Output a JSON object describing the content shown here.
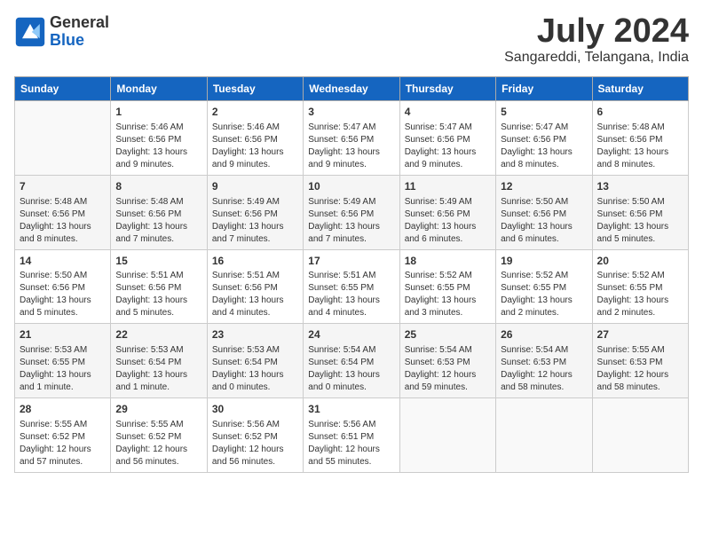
{
  "logo": {
    "text_general": "General",
    "text_blue": "Blue"
  },
  "title": "July 2024",
  "location": "Sangareddi, Telangana, India",
  "days_of_week": [
    "Sunday",
    "Monday",
    "Tuesday",
    "Wednesday",
    "Thursday",
    "Friday",
    "Saturday"
  ],
  "weeks": [
    [
      {
        "day": "",
        "info": ""
      },
      {
        "day": "1",
        "info": "Sunrise: 5:46 AM\nSunset: 6:56 PM\nDaylight: 13 hours\nand 9 minutes."
      },
      {
        "day": "2",
        "info": "Sunrise: 5:46 AM\nSunset: 6:56 PM\nDaylight: 13 hours\nand 9 minutes."
      },
      {
        "day": "3",
        "info": "Sunrise: 5:47 AM\nSunset: 6:56 PM\nDaylight: 13 hours\nand 9 minutes."
      },
      {
        "day": "4",
        "info": "Sunrise: 5:47 AM\nSunset: 6:56 PM\nDaylight: 13 hours\nand 9 minutes."
      },
      {
        "day": "5",
        "info": "Sunrise: 5:47 AM\nSunset: 6:56 PM\nDaylight: 13 hours\nand 8 minutes."
      },
      {
        "day": "6",
        "info": "Sunrise: 5:48 AM\nSunset: 6:56 PM\nDaylight: 13 hours\nand 8 minutes."
      }
    ],
    [
      {
        "day": "7",
        "info": "Sunrise: 5:48 AM\nSunset: 6:56 PM\nDaylight: 13 hours\nand 8 minutes."
      },
      {
        "day": "8",
        "info": "Sunrise: 5:48 AM\nSunset: 6:56 PM\nDaylight: 13 hours\nand 7 minutes."
      },
      {
        "day": "9",
        "info": "Sunrise: 5:49 AM\nSunset: 6:56 PM\nDaylight: 13 hours\nand 7 minutes."
      },
      {
        "day": "10",
        "info": "Sunrise: 5:49 AM\nSunset: 6:56 PM\nDaylight: 13 hours\nand 7 minutes."
      },
      {
        "day": "11",
        "info": "Sunrise: 5:49 AM\nSunset: 6:56 PM\nDaylight: 13 hours\nand 6 minutes."
      },
      {
        "day": "12",
        "info": "Sunrise: 5:50 AM\nSunset: 6:56 PM\nDaylight: 13 hours\nand 6 minutes."
      },
      {
        "day": "13",
        "info": "Sunrise: 5:50 AM\nSunset: 6:56 PM\nDaylight: 13 hours\nand 5 minutes."
      }
    ],
    [
      {
        "day": "14",
        "info": "Sunrise: 5:50 AM\nSunset: 6:56 PM\nDaylight: 13 hours\nand 5 minutes."
      },
      {
        "day": "15",
        "info": "Sunrise: 5:51 AM\nSunset: 6:56 PM\nDaylight: 13 hours\nand 5 minutes."
      },
      {
        "day": "16",
        "info": "Sunrise: 5:51 AM\nSunset: 6:56 PM\nDaylight: 13 hours\nand 4 minutes."
      },
      {
        "day": "17",
        "info": "Sunrise: 5:51 AM\nSunset: 6:55 PM\nDaylight: 13 hours\nand 4 minutes."
      },
      {
        "day": "18",
        "info": "Sunrise: 5:52 AM\nSunset: 6:55 PM\nDaylight: 13 hours\nand 3 minutes."
      },
      {
        "day": "19",
        "info": "Sunrise: 5:52 AM\nSunset: 6:55 PM\nDaylight: 13 hours\nand 2 minutes."
      },
      {
        "day": "20",
        "info": "Sunrise: 5:52 AM\nSunset: 6:55 PM\nDaylight: 13 hours\nand 2 minutes."
      }
    ],
    [
      {
        "day": "21",
        "info": "Sunrise: 5:53 AM\nSunset: 6:55 PM\nDaylight: 13 hours\nand 1 minute."
      },
      {
        "day": "22",
        "info": "Sunrise: 5:53 AM\nSunset: 6:54 PM\nDaylight: 13 hours\nand 1 minute."
      },
      {
        "day": "23",
        "info": "Sunrise: 5:53 AM\nSunset: 6:54 PM\nDaylight: 13 hours\nand 0 minutes."
      },
      {
        "day": "24",
        "info": "Sunrise: 5:54 AM\nSunset: 6:54 PM\nDaylight: 13 hours\nand 0 minutes."
      },
      {
        "day": "25",
        "info": "Sunrise: 5:54 AM\nSunset: 6:53 PM\nDaylight: 12 hours\nand 59 minutes."
      },
      {
        "day": "26",
        "info": "Sunrise: 5:54 AM\nSunset: 6:53 PM\nDaylight: 12 hours\nand 58 minutes."
      },
      {
        "day": "27",
        "info": "Sunrise: 5:55 AM\nSunset: 6:53 PM\nDaylight: 12 hours\nand 58 minutes."
      }
    ],
    [
      {
        "day": "28",
        "info": "Sunrise: 5:55 AM\nSunset: 6:52 PM\nDaylight: 12 hours\nand 57 minutes."
      },
      {
        "day": "29",
        "info": "Sunrise: 5:55 AM\nSunset: 6:52 PM\nDaylight: 12 hours\nand 56 minutes."
      },
      {
        "day": "30",
        "info": "Sunrise: 5:56 AM\nSunset: 6:52 PM\nDaylight: 12 hours\nand 56 minutes."
      },
      {
        "day": "31",
        "info": "Sunrise: 5:56 AM\nSunset: 6:51 PM\nDaylight: 12 hours\nand 55 minutes."
      },
      {
        "day": "",
        "info": ""
      },
      {
        "day": "",
        "info": ""
      },
      {
        "day": "",
        "info": ""
      }
    ]
  ]
}
